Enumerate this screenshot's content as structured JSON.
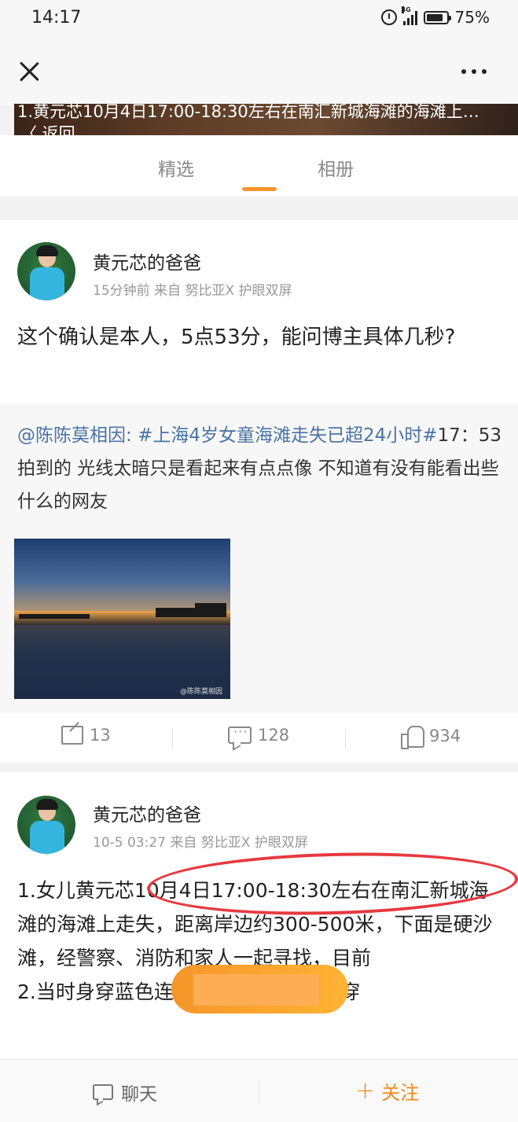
{
  "status_bar": {
    "time": "14:17",
    "network": "4G",
    "battery": "75%"
  },
  "banner": {
    "text": "1.黄元芯10月4日17:00-18:30左右在南汇新城海滩的海滩上…",
    "back_label": "〈 返回"
  },
  "tabs": [
    {
      "label": "精选",
      "active": true
    },
    {
      "label": "相册",
      "active": false
    }
  ],
  "post1": {
    "author": "黄元芯的爸爸",
    "meta": "15分钟前  来自 努比亚X 护眼双屏",
    "text": "这个确认是本人，5点53分，能问博主具体几秒?",
    "repost": {
      "mention": "@陈陈莫相因:",
      "hashtag": "#上海4岁女童海滩走失已超24小时#",
      "body": "17：53拍到的 光线太暗只是看起来有点点像 不知道有没有能看出些什么的网友",
      "image_watermark": "@陈陈莫相因"
    },
    "actions": {
      "reposts": "13",
      "comments": "128",
      "likes": "934"
    }
  },
  "post2": {
    "author": "黄元芯的爸爸",
    "meta": "10-5 03:27  来自 努比亚X 护眼双屏",
    "line1": "1.女儿黄元芯10月4日17:00-18:30左右在南汇新城海滩的海滩上走失，距离岸边约300-500米，下面是硬沙滩，经警察、消防和家人一起寻找，目前",
    "line2": "2.当时身穿蓝色连衣裙（如下图），未穿"
  },
  "bottom_bar": {
    "chat_label": "聊天",
    "follow_label": "关注"
  },
  "colors": {
    "accent": "#f7942a",
    "link": "#4a74a5",
    "annotation_red": "#e6393f"
  }
}
